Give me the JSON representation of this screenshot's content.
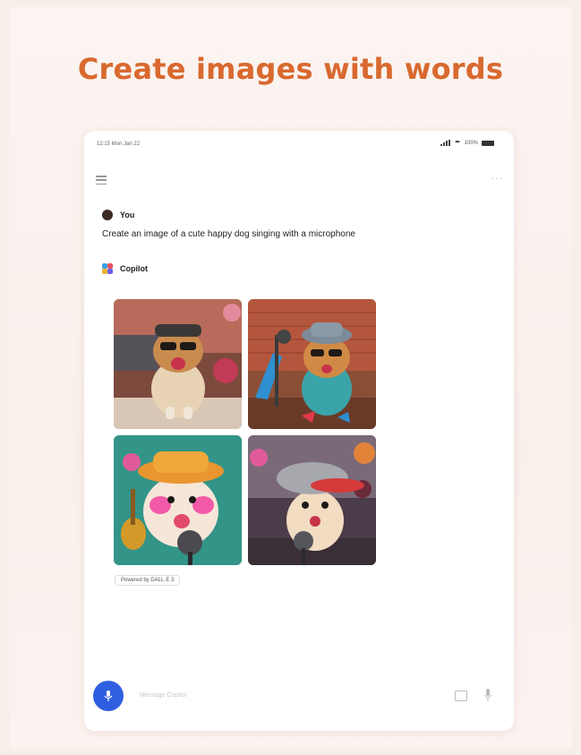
{
  "headline": "Create images with words",
  "status_bar": {
    "time": "12:15  Mon Jan 22",
    "battery": "100%"
  },
  "chat": {
    "user_name": "You",
    "prompt": "Create an image of a cute happy dog singing with a microphone",
    "assistant_name": "Copilot"
  },
  "images": [
    {
      "alt": "Dog wearing sunglasses and cap, singing"
    },
    {
      "alt": "Dog in teal shirt with hat and guitar at microphone"
    },
    {
      "alt": "Fluffy dog in yellow hat with pink flowers and microphone"
    },
    {
      "alt": "Puppy in grey cap holding microphone"
    }
  ],
  "powered_by": "Powered by DALL·E 3",
  "composer": {
    "placeholder": "Message Copilot"
  },
  "colors": {
    "headline": "#d9692f",
    "mic_button": "#2f5fe0"
  }
}
